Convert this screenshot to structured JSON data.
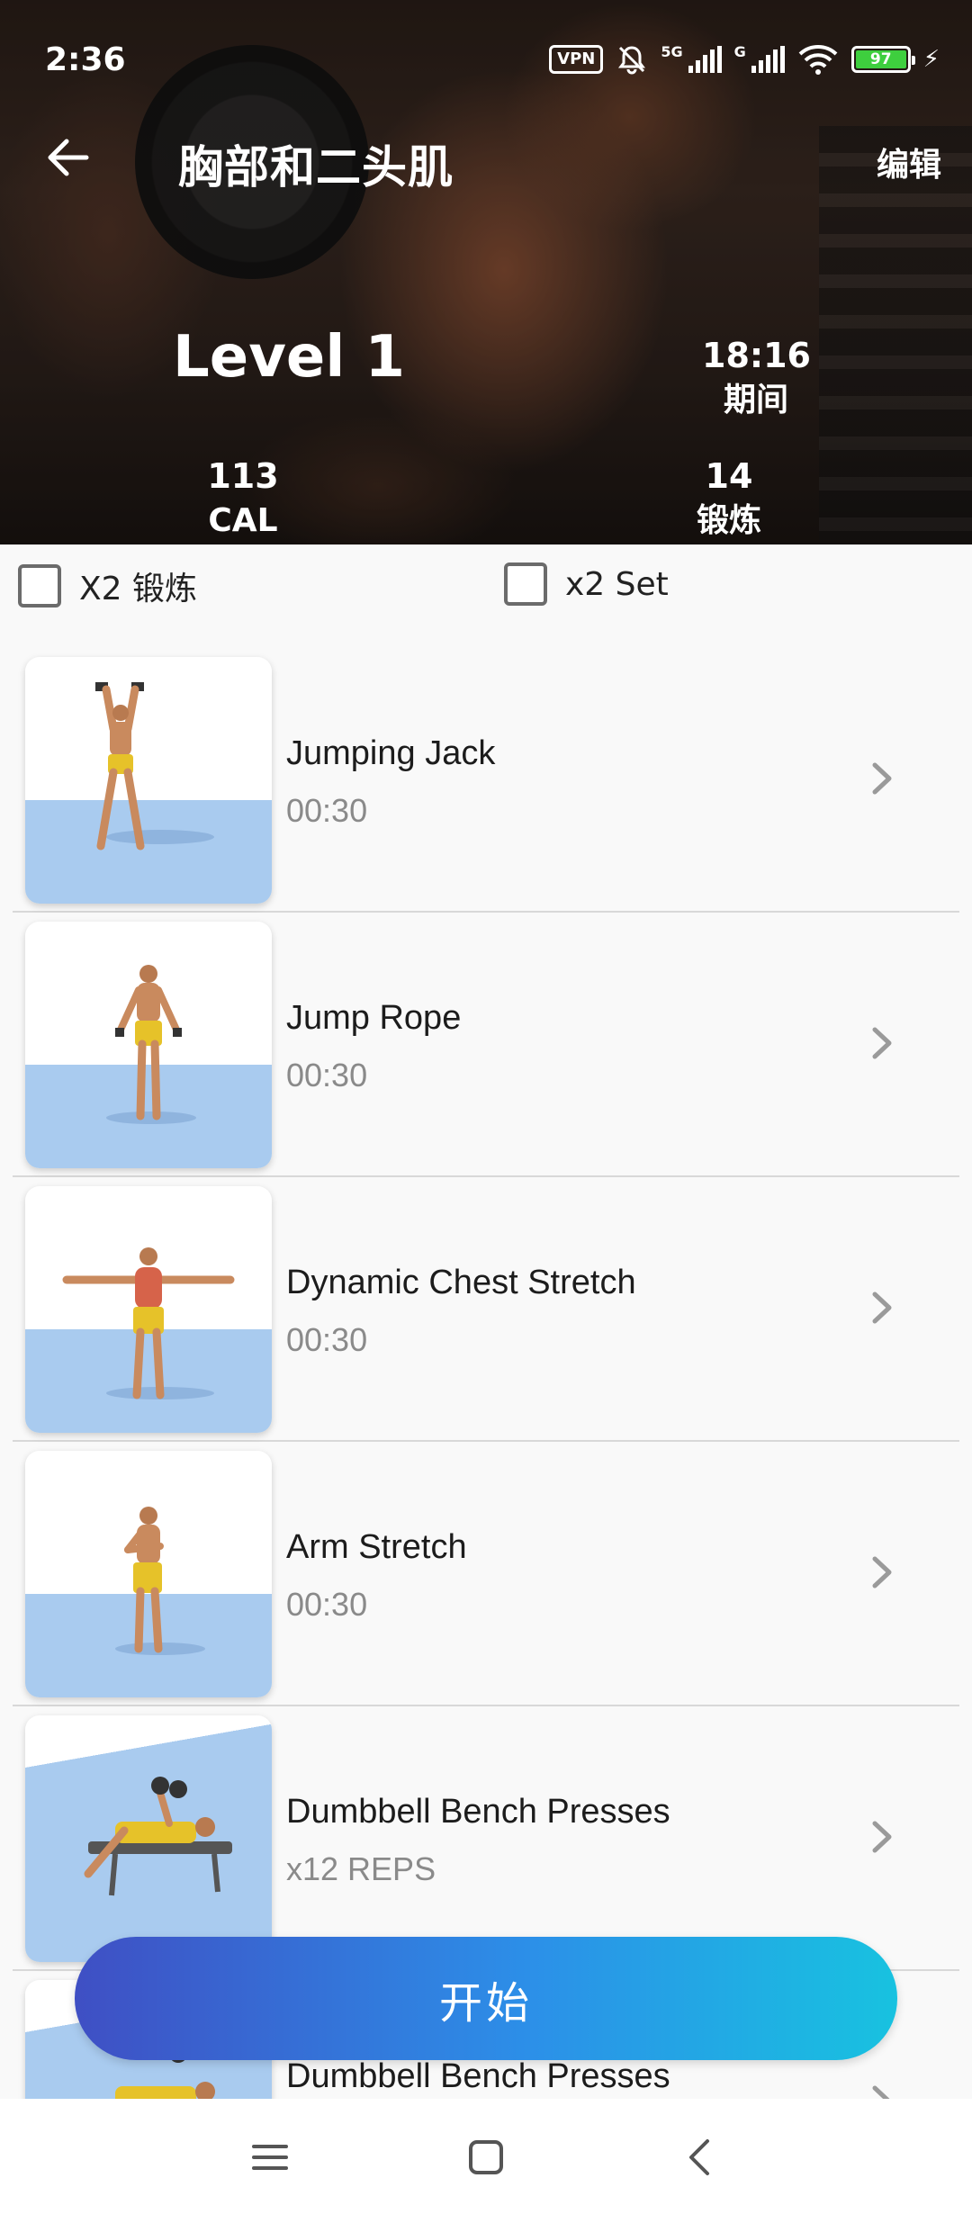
{
  "status_bar": {
    "time": "2:36",
    "vpn": "VPN",
    "network_5g": "5G",
    "network_g": "G",
    "battery": "97"
  },
  "header": {
    "title": "胸部和二头肌",
    "edit_label": "编辑",
    "level": "Level 1",
    "duration_value": "18:16",
    "duration_label": "期间",
    "calories_value": "113",
    "calories_label": "CAL",
    "exercises_value": "14",
    "exercises_label": "锻炼"
  },
  "options": {
    "double_exercise_label": "X2 锻炼",
    "double_set_label": "x2 Set",
    "double_exercise_checked": false,
    "double_set_checked": false
  },
  "exercises": [
    {
      "name": "Jumping Jack",
      "detail": "00:30"
    },
    {
      "name": "Jump Rope",
      "detail": "00:30"
    },
    {
      "name": "Dynamic Chest Stretch",
      "detail": "00:30"
    },
    {
      "name": "Arm Stretch",
      "detail": "00:30"
    },
    {
      "name": "Dumbbell Bench Presses",
      "detail": "x12 REPS"
    },
    {
      "name": "Dumbbell Bench Presses",
      "detail": ""
    }
  ],
  "start_button": {
    "label": "开始"
  },
  "colors": {
    "accent_start": "#3f4fc4",
    "accent_end": "#18c2e0",
    "battery": "#3ecf3e"
  }
}
